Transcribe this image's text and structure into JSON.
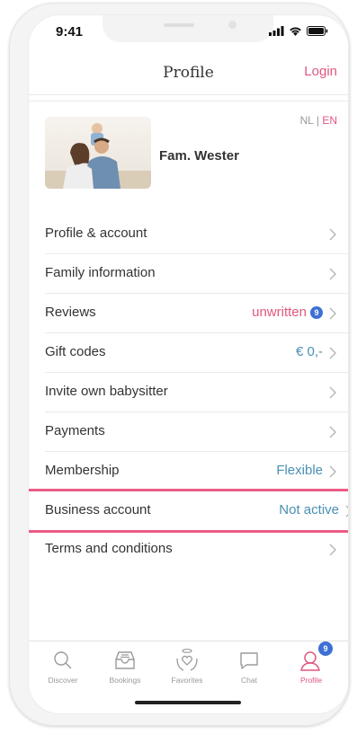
{
  "status": {
    "time": "9:41"
  },
  "header": {
    "title": "Profile",
    "login": "Login"
  },
  "languages": {
    "nl": "NL",
    "sep": "|",
    "en": "EN"
  },
  "profile": {
    "name": "Fam. Wester"
  },
  "menu": [
    {
      "label": "Profile & account",
      "value": ""
    },
    {
      "label": "Family information",
      "value": ""
    },
    {
      "label": "Reviews",
      "value": "unwritten",
      "badge": "9"
    },
    {
      "label": "Gift codes",
      "value": "€ 0,-"
    },
    {
      "label": "Invite own babysitter",
      "value": ""
    },
    {
      "label": "Payments",
      "value": ""
    },
    {
      "label": "Membership",
      "value": "Flexible"
    },
    {
      "label": "Business account",
      "value": "Not active"
    },
    {
      "label": "Terms and conditions",
      "value": ""
    }
  ],
  "tabs": [
    {
      "label": "Discover",
      "icon": "search-icon"
    },
    {
      "label": "Bookings",
      "icon": "inbox-icon"
    },
    {
      "label": "Favorites",
      "icon": "heart-hands-icon"
    },
    {
      "label": "Chat",
      "icon": "chat-icon"
    },
    {
      "label": "Profile",
      "icon": "user-icon",
      "badge": "9",
      "active": true
    }
  ],
  "colors": {
    "accent": "#e2577f",
    "link": "#4a8fb5",
    "badge": "#3d6fd4",
    "highlight": "#ec5b86"
  }
}
